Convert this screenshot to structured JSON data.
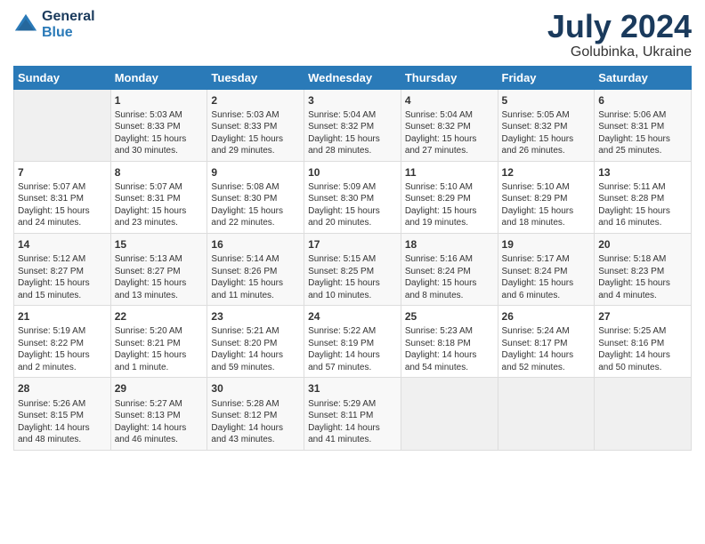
{
  "header": {
    "logo_line1": "General",
    "logo_line2": "Blue",
    "month": "July 2024",
    "location": "Golubinka, Ukraine"
  },
  "days_of_week": [
    "Sunday",
    "Monday",
    "Tuesday",
    "Wednesday",
    "Thursday",
    "Friday",
    "Saturday"
  ],
  "weeks": [
    [
      {
        "day": "",
        "info": ""
      },
      {
        "day": "1",
        "info": "Sunrise: 5:03 AM\nSunset: 8:33 PM\nDaylight: 15 hours\nand 30 minutes."
      },
      {
        "day": "2",
        "info": "Sunrise: 5:03 AM\nSunset: 8:33 PM\nDaylight: 15 hours\nand 29 minutes."
      },
      {
        "day": "3",
        "info": "Sunrise: 5:04 AM\nSunset: 8:32 PM\nDaylight: 15 hours\nand 28 minutes."
      },
      {
        "day": "4",
        "info": "Sunrise: 5:04 AM\nSunset: 8:32 PM\nDaylight: 15 hours\nand 27 minutes."
      },
      {
        "day": "5",
        "info": "Sunrise: 5:05 AM\nSunset: 8:32 PM\nDaylight: 15 hours\nand 26 minutes."
      },
      {
        "day": "6",
        "info": "Sunrise: 5:06 AM\nSunset: 8:31 PM\nDaylight: 15 hours\nand 25 minutes."
      }
    ],
    [
      {
        "day": "7",
        "info": "Sunrise: 5:07 AM\nSunset: 8:31 PM\nDaylight: 15 hours\nand 24 minutes."
      },
      {
        "day": "8",
        "info": "Sunrise: 5:07 AM\nSunset: 8:31 PM\nDaylight: 15 hours\nand 23 minutes."
      },
      {
        "day": "9",
        "info": "Sunrise: 5:08 AM\nSunset: 8:30 PM\nDaylight: 15 hours\nand 22 minutes."
      },
      {
        "day": "10",
        "info": "Sunrise: 5:09 AM\nSunset: 8:30 PM\nDaylight: 15 hours\nand 20 minutes."
      },
      {
        "day": "11",
        "info": "Sunrise: 5:10 AM\nSunset: 8:29 PM\nDaylight: 15 hours\nand 19 minutes."
      },
      {
        "day": "12",
        "info": "Sunrise: 5:10 AM\nSunset: 8:29 PM\nDaylight: 15 hours\nand 18 minutes."
      },
      {
        "day": "13",
        "info": "Sunrise: 5:11 AM\nSunset: 8:28 PM\nDaylight: 15 hours\nand 16 minutes."
      }
    ],
    [
      {
        "day": "14",
        "info": "Sunrise: 5:12 AM\nSunset: 8:27 PM\nDaylight: 15 hours\nand 15 minutes."
      },
      {
        "day": "15",
        "info": "Sunrise: 5:13 AM\nSunset: 8:27 PM\nDaylight: 15 hours\nand 13 minutes."
      },
      {
        "day": "16",
        "info": "Sunrise: 5:14 AM\nSunset: 8:26 PM\nDaylight: 15 hours\nand 11 minutes."
      },
      {
        "day": "17",
        "info": "Sunrise: 5:15 AM\nSunset: 8:25 PM\nDaylight: 15 hours\nand 10 minutes."
      },
      {
        "day": "18",
        "info": "Sunrise: 5:16 AM\nSunset: 8:24 PM\nDaylight: 15 hours\nand 8 minutes."
      },
      {
        "day": "19",
        "info": "Sunrise: 5:17 AM\nSunset: 8:24 PM\nDaylight: 15 hours\nand 6 minutes."
      },
      {
        "day": "20",
        "info": "Sunrise: 5:18 AM\nSunset: 8:23 PM\nDaylight: 15 hours\nand 4 minutes."
      }
    ],
    [
      {
        "day": "21",
        "info": "Sunrise: 5:19 AM\nSunset: 8:22 PM\nDaylight: 15 hours\nand 2 minutes."
      },
      {
        "day": "22",
        "info": "Sunrise: 5:20 AM\nSunset: 8:21 PM\nDaylight: 15 hours\nand 1 minute."
      },
      {
        "day": "23",
        "info": "Sunrise: 5:21 AM\nSunset: 8:20 PM\nDaylight: 14 hours\nand 59 minutes."
      },
      {
        "day": "24",
        "info": "Sunrise: 5:22 AM\nSunset: 8:19 PM\nDaylight: 14 hours\nand 57 minutes."
      },
      {
        "day": "25",
        "info": "Sunrise: 5:23 AM\nSunset: 8:18 PM\nDaylight: 14 hours\nand 54 minutes."
      },
      {
        "day": "26",
        "info": "Sunrise: 5:24 AM\nSunset: 8:17 PM\nDaylight: 14 hours\nand 52 minutes."
      },
      {
        "day": "27",
        "info": "Sunrise: 5:25 AM\nSunset: 8:16 PM\nDaylight: 14 hours\nand 50 minutes."
      }
    ],
    [
      {
        "day": "28",
        "info": "Sunrise: 5:26 AM\nSunset: 8:15 PM\nDaylight: 14 hours\nand 48 minutes."
      },
      {
        "day": "29",
        "info": "Sunrise: 5:27 AM\nSunset: 8:13 PM\nDaylight: 14 hours\nand 46 minutes."
      },
      {
        "day": "30",
        "info": "Sunrise: 5:28 AM\nSunset: 8:12 PM\nDaylight: 14 hours\nand 43 minutes."
      },
      {
        "day": "31",
        "info": "Sunrise: 5:29 AM\nSunset: 8:11 PM\nDaylight: 14 hours\nand 41 minutes."
      },
      {
        "day": "",
        "info": ""
      },
      {
        "day": "",
        "info": ""
      },
      {
        "day": "",
        "info": ""
      }
    ]
  ]
}
